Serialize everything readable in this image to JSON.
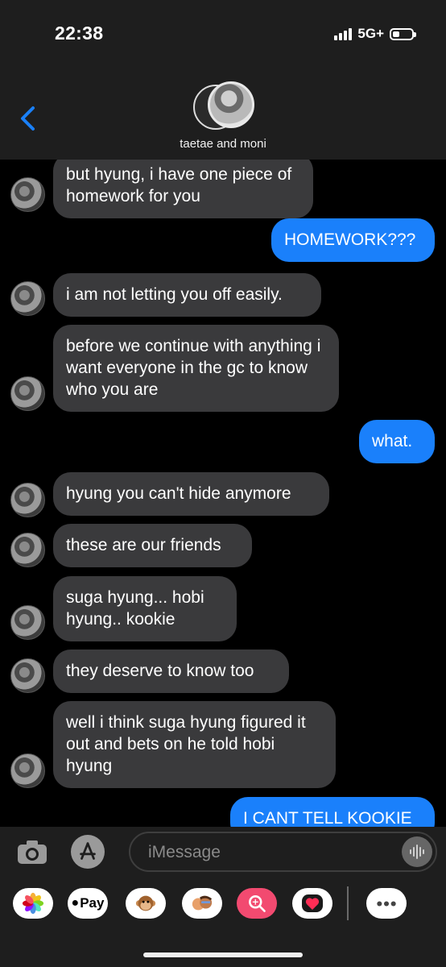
{
  "status": {
    "time": "22:38",
    "network": "5G+"
  },
  "header": {
    "group_name": "taetae and moni"
  },
  "messages": [
    {
      "type": "in",
      "text": "but hyung, i have one piece of homework for you"
    },
    {
      "type": "out",
      "text": "HOMEWORK???"
    },
    {
      "type": "in",
      "text": "i am not letting you off easily."
    },
    {
      "type": "in",
      "text": "before we continue with anything i want everyone in the gc to know who you are"
    },
    {
      "type": "out",
      "text": "what."
    },
    {
      "type": "in",
      "text": "hyung you can't hide anymore"
    },
    {
      "type": "in",
      "text": "these are our friends"
    },
    {
      "type": "in",
      "text": "suga hyung... hobi hyung.. kookie"
    },
    {
      "type": "in",
      "text": "they deserve to know too"
    },
    {
      "type": "in",
      "text": "well i think suga hyung figured it out and bets on he told hobi hyung"
    },
    {
      "type": "out",
      "text": "I CANT TELL KOOKIE"
    }
  ],
  "composer": {
    "placeholder": "iMessage"
  },
  "app_drawer": {
    "pay_label": "Pay"
  },
  "icons": [
    "back-chevron-icon",
    "camera-icon",
    "app-store-icon",
    "audio-waveform-icon",
    "photos-icon",
    "apple-pay-icon",
    "monkey-memoji-icon",
    "memoji-stickers-icon",
    "image-search-icon",
    "digital-touch-heart-icon",
    "more-apps-icon"
  ],
  "colors": {
    "accent": "#1a80fb",
    "incoming_bubble": "#3a3a3c",
    "background": "#000000",
    "bar": "#1e1e1e"
  }
}
